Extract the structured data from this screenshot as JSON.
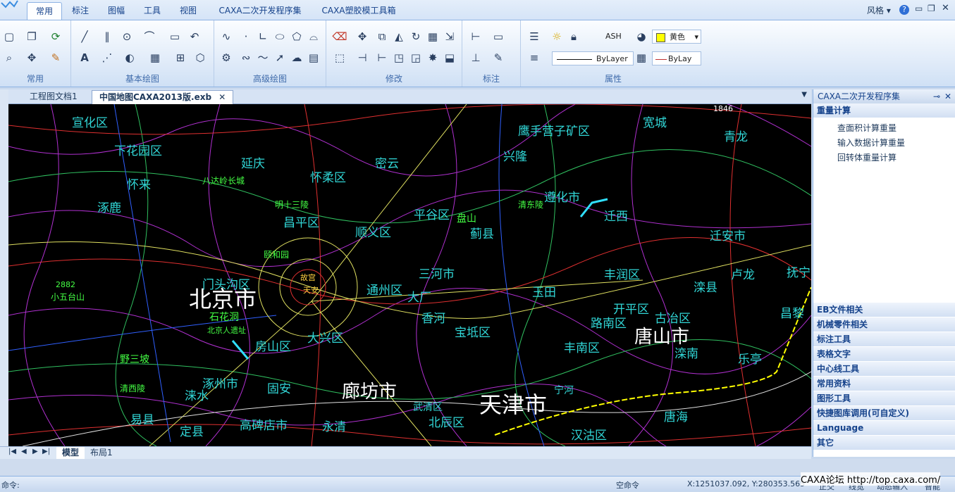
{
  "ribbon": {
    "tabs": [
      "常用",
      "标注",
      "图幅",
      "工具",
      "视图",
      "CAXA二次开发程序集",
      "CAXA塑胶模工具箱"
    ],
    "active_tab": 0,
    "right": {
      "style_label": "风格"
    },
    "groups": [
      "常用",
      "基本绘图",
      "高级绘图",
      "修改",
      "标注",
      "属性"
    ],
    "properties": {
      "layer_name": "ASH",
      "color_name": "黄色",
      "linetype": "ByLayer",
      "lineweight": "ByLay"
    }
  },
  "documents": {
    "tabs": [
      "工程图文档1",
      "中国地图CAXA2013版.exb"
    ],
    "active": 1
  },
  "layout_tabs": [
    "模型",
    "布局1"
  ],
  "right_panel": {
    "title": "CAXA二次开发程序集",
    "sections_top": [
      {
        "title": "重量计算",
        "items": [
          "查面积计算重量",
          "输入数据计算重量",
          "回转体重量计算"
        ]
      }
    ],
    "sections_bottom": [
      "EB文件相关",
      "机械零件相关",
      "标注工具",
      "表格文字",
      "中心线工具",
      "常用资料",
      "图形工具",
      "快捷图库调用(可自定义)",
      "Language",
      "其它"
    ]
  },
  "command": {
    "prompt": "命令:"
  },
  "status": {
    "mode": "空命令",
    "coords": "X:1251037.092, Y:280353.565",
    "toggles": [
      "正交",
      "线宽",
      "动态输入",
      "智能"
    ],
    "watermark": "CAXA论坛 http://top.caxa.com/"
  },
  "map": {
    "colors": {
      "background": "#000000",
      "major": "#ffffff",
      "district": "#31d6d6",
      "town": "#ff3030",
      "site": "#44ff44"
    },
    "major_cities": [
      "北京市",
      "廊坊市",
      "天津市",
      "唐山市"
    ],
    "districts": [
      "宣化区",
      "下花园区",
      "怀来",
      "涿鹿",
      "延庆",
      "怀柔区",
      "密云",
      "兴隆",
      "鹰手营子矿区",
      "宽城",
      "青龙",
      "遵化市",
      "迁西",
      "平谷区",
      "盘山",
      "蓟县",
      "顺义区",
      "昌平区",
      "门头沟区",
      "通州区",
      "大厂",
      "三河市",
      "玉田",
      "丰润区",
      "迁安市",
      "卢龙",
      "抚宁",
      "滦县",
      "昌黎",
      "古冶区",
      "开平区",
      "路南区",
      "丰南区",
      "滦南",
      "乐亭",
      "唐海",
      "宝坻区",
      "香河",
      "大兴区",
      "房山区",
      "涿州市",
      "固安",
      "涞水",
      "易县",
      "定县",
      "高碑店市",
      "永清",
      "武清区",
      "北辰区",
      "宁河",
      "汉沽区",
      "石花洞",
      "小五台山",
      "野三坡",
      "清西陵",
      "清东陵",
      "明十三陵",
      "八达岭长城",
      "北京人遗址",
      "故宫",
      "天安",
      "颐和园"
    ],
    "elevations": [
      "1846",
      "2882"
    ]
  }
}
